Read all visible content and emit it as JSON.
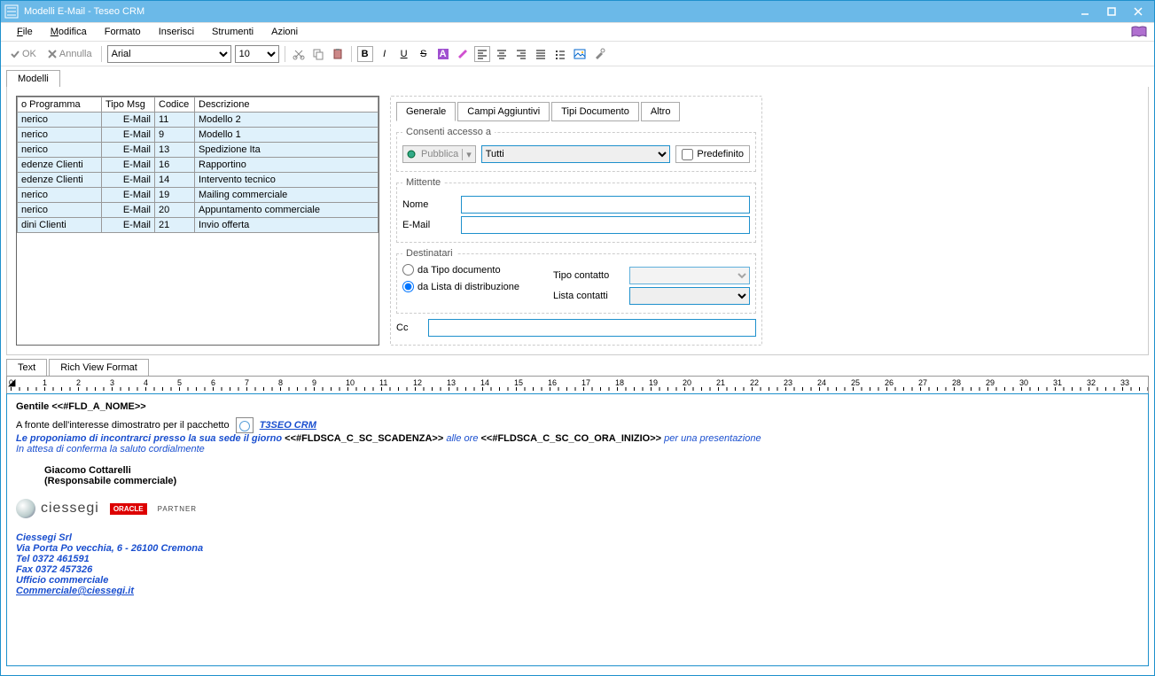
{
  "window": {
    "title": "Modelli E-Mail - Teseo CRM"
  },
  "menu": {
    "file": "File",
    "modifica": "Modifica",
    "formato": "Formato",
    "inserisci": "Inserisci",
    "strumenti": "Strumenti",
    "azioni": "Azioni"
  },
  "toolbar": {
    "ok": "OK",
    "annulla": "Annulla",
    "font": "Arial",
    "size": "10"
  },
  "tab_main": "Modelli",
  "grid": {
    "headers": [
      "o Programma",
      "Tipo Msg",
      "Codice",
      "Descrizione"
    ],
    "rows": [
      [
        "nerico",
        "E-Mail",
        "11",
        "Modello 2"
      ],
      [
        "nerico",
        "E-Mail",
        "9",
        "Modello 1"
      ],
      [
        "nerico",
        "E-Mail",
        "13",
        "Spedizione Ita"
      ],
      [
        "edenze Clienti",
        "E-Mail",
        "16",
        "Rapportino"
      ],
      [
        "edenze Clienti",
        "E-Mail",
        "14",
        "Intervento tecnico"
      ],
      [
        "nerico",
        "E-Mail",
        "19",
        "Mailing commerciale"
      ],
      [
        "nerico",
        "E-Mail",
        "20",
        "Appuntamento commerciale"
      ],
      [
        "dini Clienti",
        "E-Mail",
        "21",
        "Invio offerta"
      ]
    ]
  },
  "subtabs": {
    "t0": "Generale",
    "t1": "Campi Aggiuntivi",
    "t2": "Tipi Documento",
    "t3": "Altro"
  },
  "form": {
    "consenti_legend": "Consenti accesso a",
    "pubblica_btn": "Pubblica",
    "tutti": "Tutti",
    "predefinito": "Predefinito",
    "mittente_legend": "Mittente",
    "nome_lbl": "Nome",
    "email_lbl": "E-Mail",
    "destinatari_legend": "Destinatari",
    "r_tipo": "da Tipo documento",
    "r_lista": "da Lista di distribuzione",
    "tipo_contatto": "Tipo contatto",
    "lista_contatti": "Lista contatti",
    "cc_lbl": "Cc"
  },
  "editor_tabs": {
    "text": "Text",
    "rich": "Rich View Format"
  },
  "body": {
    "greeting_prefix": "Gentile ",
    "fld_nome": "<<#FLD_A_NOME>>",
    "line2_a": "A fronte dell'interesse dimostratro per il pacchetto",
    "product": "T3SEO CRM",
    "line3_a": "Le proponiamo di incontrarci presso la sua sede il giorno ",
    "fld_scad": "<<#FLDSCA_C_SC_SCADENZA>>",
    "alle_ore": " alle ore ",
    "fld_ora": "<<#FLDSCA_C_SC_CO_ORA_INIZIO>>",
    "line3_end": " per una presentazione",
    "line4": "In attesa di conferma la saluto cordialmente",
    "sig_name": "Giacomo Cottarelli",
    "sig_role": "(Responsabile commerciale)",
    "logo_text": "ciessegi",
    "oracle": "ORACLE",
    "partner": "PARTNER",
    "company": "Ciessegi Srl",
    "addr": "Via Porta Po vecchia, 6 - 26100 Cremona",
    "tel": "Tel 0372 461591",
    "fax": "Fax 0372 457326",
    "ufficio": "Ufficio commerciale",
    "mail": "Commerciale@ciessegi.it"
  }
}
